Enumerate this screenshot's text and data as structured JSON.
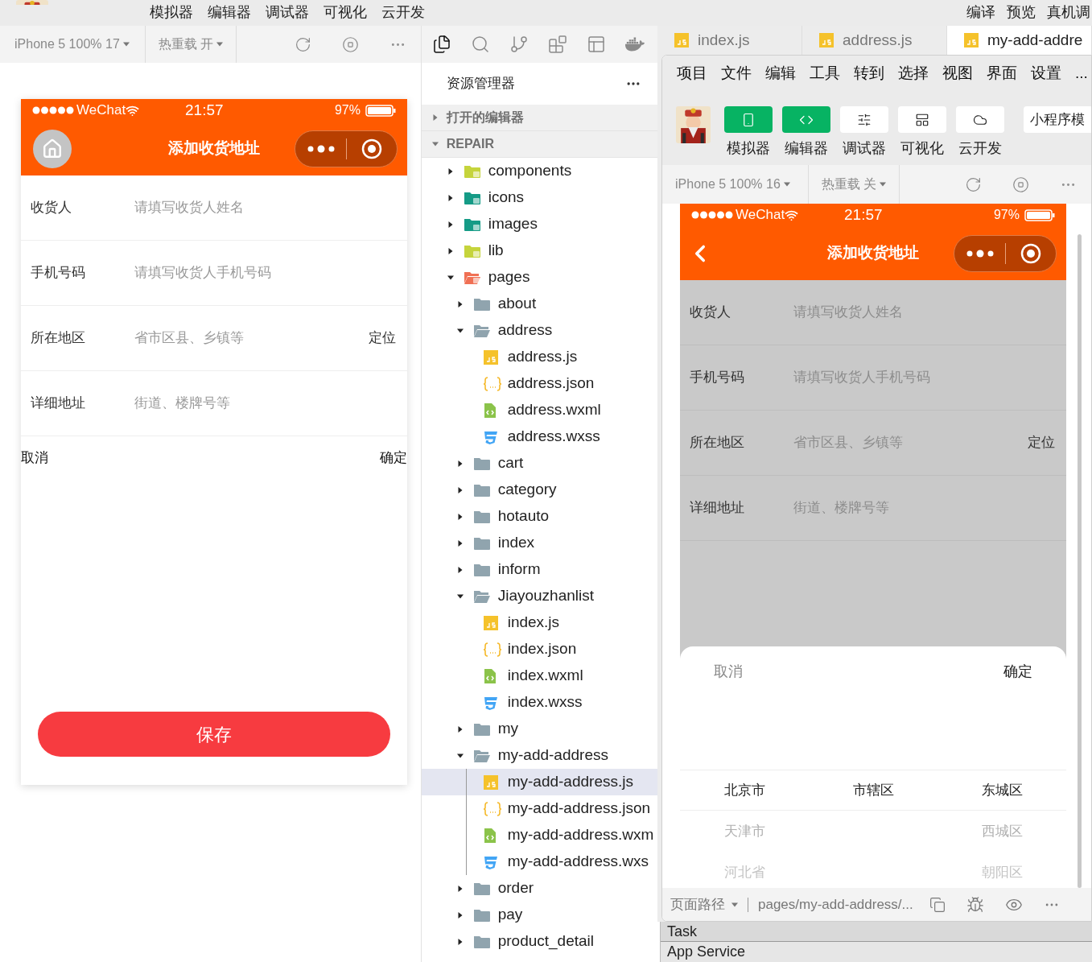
{
  "top_menu": [
    "模拟器",
    "编辑器",
    "调试器",
    "可视化",
    "云开发"
  ],
  "top_right_menu": [
    "编译",
    "预览",
    "真机调"
  ],
  "simulator_toolbar": {
    "device": "iPhone 5 100% 17",
    "hot_reload": "热重载 开"
  },
  "left_phone": {
    "status": {
      "carrier": "WeChat",
      "time": "21:57",
      "battery": "97%"
    },
    "nav": {
      "kind": "home"
    },
    "title": "添加收货地址",
    "fields": [
      {
        "label": "收货人",
        "placeholder": "请填写收货人姓名"
      },
      {
        "label": "手机号码",
        "placeholder": "请填写收货人手机号码"
      },
      {
        "label": "所在地区",
        "placeholder": "省市区县、乡镇等",
        "action": "定位"
      },
      {
        "label": "详细地址",
        "placeholder": "街道、楼牌号等"
      }
    ],
    "picker": {
      "cancel": "取消",
      "confirm": "确定"
    },
    "save_button": "保存"
  },
  "activity_bar": [
    {
      "kind": "files",
      "selected": true
    },
    {
      "kind": "search",
      "selected": false
    },
    {
      "kind": "git",
      "selected": false
    },
    {
      "kind": "extensions",
      "selected": false
    },
    {
      "kind": "layout",
      "selected": false
    },
    {
      "kind": "docker",
      "selected": false
    }
  ],
  "explorer": {
    "title": "资源管理器",
    "sections": [
      {
        "label": "打开的编辑器",
        "expanded": false
      },
      {
        "label": "REPAIR",
        "expanded": true
      }
    ],
    "tree": [
      {
        "name": "components",
        "kind": "folder-components",
        "expanded": false,
        "selected": false
      },
      {
        "name": "icons",
        "kind": "folder-media",
        "expanded": false,
        "selected": false
      },
      {
        "name": "images",
        "kind": "folder-media",
        "expanded": false,
        "selected": false
      },
      {
        "name": "lib",
        "kind": "folder-lib",
        "expanded": false,
        "selected": false
      },
      {
        "name": "pages",
        "kind": "folder-pages",
        "expanded": true,
        "selected": false,
        "children": [
          {
            "name": "about",
            "kind": "folder",
            "expanded": false,
            "selected": false
          },
          {
            "name": "address",
            "kind": "folder",
            "expanded": true,
            "selected": false,
            "children": [
              {
                "name": "address.js",
                "kind": "js",
                "selected": false
              },
              {
                "name": "address.json",
                "kind": "json",
                "selected": false
              },
              {
                "name": "address.wxml",
                "kind": "wxml",
                "selected": false
              },
              {
                "name": "address.wxss",
                "kind": "wxss",
                "selected": false
              }
            ]
          },
          {
            "name": "cart",
            "kind": "folder",
            "expanded": false,
            "selected": false
          },
          {
            "name": "category",
            "kind": "folder",
            "expanded": false,
            "selected": false
          },
          {
            "name": "hotauto",
            "kind": "folder",
            "expanded": false,
            "selected": false
          },
          {
            "name": "index",
            "kind": "folder",
            "expanded": false,
            "selected": false
          },
          {
            "name": "inform",
            "kind": "folder",
            "expanded": false,
            "selected": false
          },
          {
            "name": "Jiayouzhanlist",
            "kind": "folder",
            "expanded": true,
            "selected": false,
            "children": [
              {
                "name": "index.js",
                "kind": "js",
                "selected": false
              },
              {
                "name": "index.json",
                "kind": "json",
                "selected": false
              },
              {
                "name": "index.wxml",
                "kind": "wxml",
                "selected": false
              },
              {
                "name": "index.wxss",
                "kind": "wxss",
                "selected": false
              }
            ]
          },
          {
            "name": "my",
            "kind": "folder",
            "expanded": false,
            "selected": false
          },
          {
            "name": "my-add-address",
            "kind": "folder",
            "expanded": true,
            "selected": false,
            "children": [
              {
                "name": "my-add-address.js",
                "kind": "js",
                "selected": true
              },
              {
                "name": "my-add-address.json",
                "kind": "json",
                "selected": false
              },
              {
                "name": "my-add-address.wxm",
                "kind": "wxml",
                "selected": false
              },
              {
                "name": "my-add-address.wxs",
                "kind": "wxss",
                "selected": false
              }
            ]
          },
          {
            "name": "order",
            "kind": "folder",
            "expanded": false,
            "selected": false
          },
          {
            "name": "pay",
            "kind": "folder",
            "expanded": false,
            "selected": false
          },
          {
            "name": "product_detail",
            "kind": "folder",
            "expanded": false,
            "selected": false
          }
        ]
      }
    ]
  },
  "editor_tabs": [
    {
      "label": "index.js",
      "selected": false
    },
    {
      "label": "address.js",
      "selected": false
    },
    {
      "label": "my-add-addre",
      "selected": true
    }
  ],
  "bottom_panel": [
    "Task",
    "App Service"
  ],
  "devtools_window": {
    "menu": [
      "项目",
      "文件",
      "编辑",
      "工具",
      "转到",
      "选择",
      "视图",
      "界面",
      "设置",
      "..."
    ],
    "tool_buttons": [
      {
        "kind": "simulator",
        "label": "模拟器",
        "on": true
      },
      {
        "kind": "editor",
        "label": "编辑器",
        "on": true
      },
      {
        "kind": "debugger",
        "label": "调试器",
        "on": false
      },
      {
        "kind": "visual",
        "label": "可视化",
        "on": false
      },
      {
        "kind": "cloud",
        "label": "云开发",
        "on": false
      }
    ],
    "mode_button": "小程序模",
    "simulator_toolbar": {
      "device": "iPhone 5 100% 16",
      "hot_reload": "热重载 关"
    },
    "phone": {
      "status": {
        "carrier": "WeChat",
        "time": "21:57",
        "battery": "97%"
      },
      "nav": {
        "kind": "back"
      },
      "title": "添加收货地址",
      "dimmed": true,
      "fields": [
        {
          "label": "收货人",
          "placeholder": "请填写收货人姓名"
        },
        {
          "label": "手机号码",
          "placeholder": "请填写收货人手机号码"
        },
        {
          "label": "所在地区",
          "placeholder": "省市区县、乡镇等",
          "action": "定位"
        },
        {
          "label": "详细地址",
          "placeholder": "街道、楼牌号等"
        }
      ],
      "picker": {
        "cancel": "取消",
        "confirm": "确定",
        "columns": [
          [
            {
              "label": "北京市",
              "selected": true
            },
            {
              "label": "天津市",
              "selected": false
            },
            {
              "label": "河北省",
              "selected": false
            }
          ],
          [
            {
              "label": "市辖区",
              "selected": true
            }
          ],
          [
            {
              "label": "东城区",
              "selected": true
            },
            {
              "label": "西城区",
              "selected": false
            },
            {
              "label": "朝阳区",
              "selected": false
            }
          ]
        ]
      }
    },
    "path_bar": {
      "label": "页面路径",
      "path": "pages/my-add-address/..."
    }
  }
}
